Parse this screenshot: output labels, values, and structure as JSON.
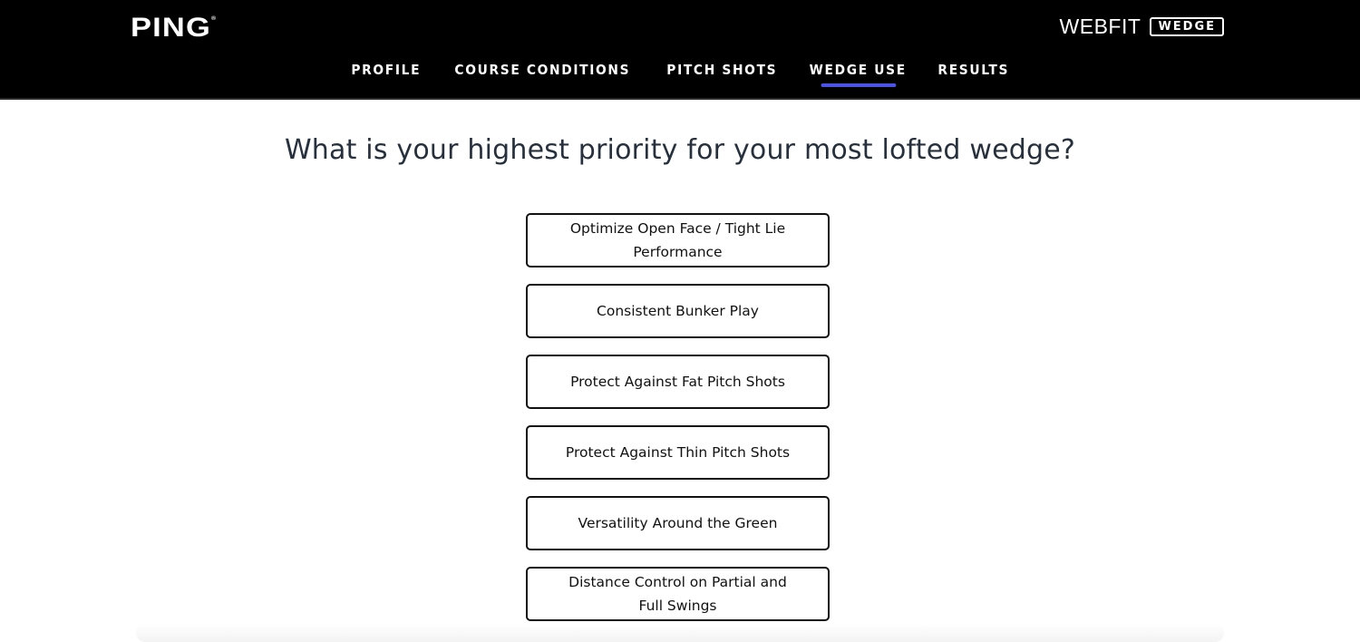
{
  "header": {
    "logo": "PING",
    "logo_mark": "®",
    "brand_name": "WEBFIT",
    "brand_badge": "WEDGE",
    "accent_color": "#4b52e6"
  },
  "nav": {
    "items": [
      {
        "label": "PROFILE",
        "active": false
      },
      {
        "label": "COURSE CONDITIONS",
        "active": false
      },
      {
        "label": "PITCH SHOTS",
        "active": false
      },
      {
        "label": "WEDGE USE",
        "active": true
      },
      {
        "label": "RESULTS",
        "active": false
      }
    ]
  },
  "main": {
    "question": "What is your highest priority for your most lofted wedge?",
    "options": [
      {
        "label": "Optimize Open Face / Tight Lie Performance"
      },
      {
        "label": "Consistent Bunker Play"
      },
      {
        "label": "Protect Against Fat Pitch Shots"
      },
      {
        "label": "Protect Against Thin Pitch Shots"
      },
      {
        "label": "Versatility Around the Green"
      },
      {
        "label": "Distance Control on Partial and Full Swings"
      }
    ]
  }
}
